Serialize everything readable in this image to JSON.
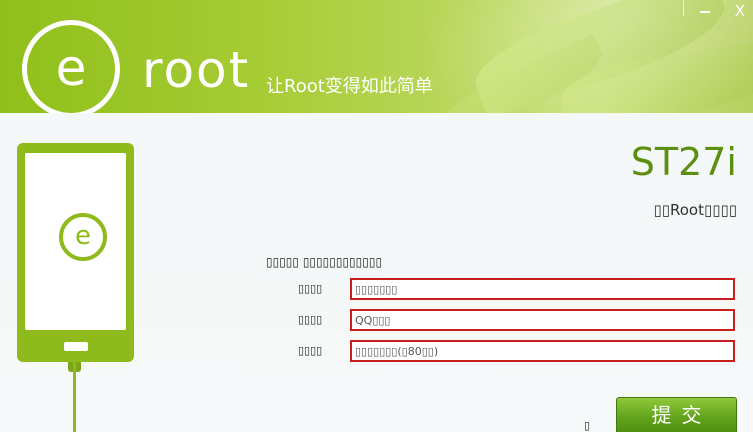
{
  "header": {
    "logo_letter": "e",
    "brand": "root",
    "slogan": "让Root变得如此简单",
    "close_glyph": "X"
  },
  "device": {
    "model": "ST27i",
    "subtitle": "▯▯Root▯▯▯▯"
  },
  "form": {
    "title": "▯▯▯▯▯ ▯▯▯▯▯▯▯▯▯▯▯▯",
    "fields": [
      {
        "label": "▯▯▯▯",
        "value": "▯▯▯▯▯▯▯"
      },
      {
        "label": "▯▯▯▯",
        "value": "QQ▯▯▯"
      },
      {
        "label": "▯▯▯▯",
        "value": "▯▯▯▯▯▯▯(▯80▯▯)"
      }
    ],
    "submit_label": "提交",
    "small_mark": "▯"
  },
  "icons": {
    "logo": "e-logo-icon",
    "phone": "phone-icon",
    "close": "close-icon",
    "minimize": "minimize-icon"
  },
  "colors": {
    "brand_green": "#8fba1c",
    "title_green": "#5c8f10",
    "input_border": "#c81e1e",
    "button_green": "#63a51d"
  }
}
